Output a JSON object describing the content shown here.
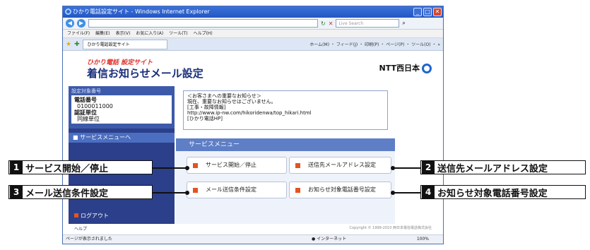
{
  "window": {
    "title": "ひかり電話設定サイト - Windows Internet Explorer",
    "tab": "ひかり電話設定サイト",
    "search_placeholder": "Live Search"
  },
  "menu": [
    "ファイル(F)",
    "編集(E)",
    "表示(V)",
    "お気に入り(A)",
    "ツール(T)",
    "ヘルプ(H)"
  ],
  "toolbar_text": "ホーム(M) ・ フィード(J) ・ 印刷(P) ・ ページ(P) ・ ツール(O) ・ »",
  "header": {
    "subtitle": "ひかり電話 設定サイト",
    "title": "着信お知らせメール設定",
    "brand": "NTT西日本"
  },
  "target": {
    "label": "設定対象番号",
    "phone_label": "電話番号",
    "phone": "0100011000",
    "unit_label": "認証単位",
    "unit": "同線単位"
  },
  "side_menu": {
    "service_menu": "サービスメニューへ",
    "logout": "ログアウト",
    "help": "ヘルプ"
  },
  "notice": {
    "lines": [
      "＜お客さまへの重要なお知らせ＞",
      "現在、重要なお知らせはございません。",
      "[工事・故障情報]",
      "http://www.ip-nw.com/hikoridenwa/top_hikari.html",
      "[ひかり電話HP]"
    ]
  },
  "service_menu_title": "サービスメニュー",
  "buttons": {
    "b1": "サービス開始／停止",
    "b2": "送信先メールアドレス設定",
    "b3": "メール送信条件設定",
    "b4": "お知らせ対象電話番号設定"
  },
  "callouts": [
    {
      "num": "1",
      "label": "サービス開始／停止"
    },
    {
      "num": "2",
      "label": "送信先メールアドレス設定"
    },
    {
      "num": "3",
      "label": "メール送信条件設定"
    },
    {
      "num": "4",
      "label": "お知らせ対象電話番号設定"
    }
  ],
  "copyright": "Copyright © 1999-2010 西日本電信電話株式会社",
  "status": {
    "text": "ページが表示されました",
    "zone": "インターネット",
    "zoom": "100%"
  }
}
